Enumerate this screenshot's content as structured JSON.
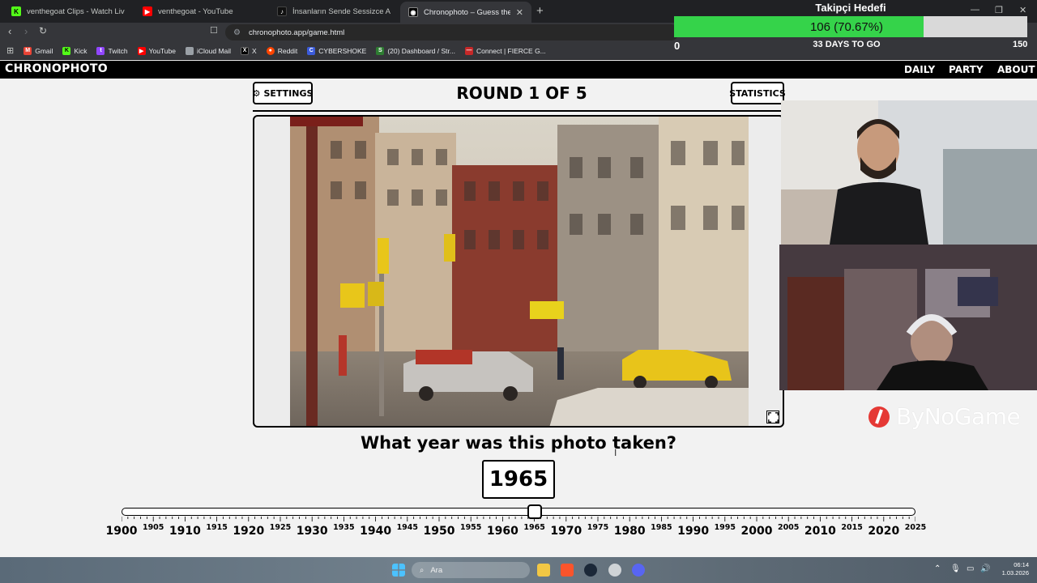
{
  "browser": {
    "tabs": [
      {
        "title": "venthegoat Clips - Watch Live on Kick",
        "icon": "kick-icon",
        "color": "#53fc18"
      },
      {
        "title": "venthegoat - YouTube",
        "icon": "youtube-icon",
        "color": "#ff0000"
      },
      {
        "title": "İnsanların Sende Sessizce Alkışladığı",
        "icon": "tiktok-icon",
        "color": "#111111"
      },
      {
        "title": "Chronophoto – Guess the Year of",
        "icon": "chronophoto-icon",
        "color": "#000000",
        "active": true
      }
    ],
    "url": "chronophoto.app/game.html",
    "bookmarks": [
      {
        "label": "Gmail",
        "color": "#ea4335"
      },
      {
        "label": "Kick",
        "color": "#53fc18"
      },
      {
        "label": "Twitch",
        "color": "#9146ff"
      },
      {
        "label": "YouTube",
        "color": "#ff0000"
      },
      {
        "label": "iCloud Mail",
        "color": "#9aa0a6"
      },
      {
        "label": "X",
        "color": "#000000"
      },
      {
        "label": "Reddit",
        "color": "#ff4500"
      },
      {
        "label": "CYBERSHOKE",
        "color": "#3b5bdb"
      },
      {
        "label": "(20) Dashboard / Str...",
        "color": "#2e7d32"
      },
      {
        "label": "Connect | FIERCE G...",
        "color": "#c62828"
      }
    ]
  },
  "site": {
    "logo": "CHRONOPHOTO",
    "nav": [
      "DAILY",
      "PARTY",
      "ABOUT"
    ]
  },
  "game": {
    "settings_label": "SETTINGS",
    "statistics_label": "STATISTICS",
    "round_title": "ROUND 1 OF 5",
    "question": "What year was this photo taken?",
    "selected_year": "1965",
    "slider": {
      "min": 1900,
      "max": 2025,
      "value": 1965,
      "major_ticks": [
        "1900",
        "1910",
        "1920",
        "1930",
        "1940",
        "1950",
        "1960",
        "1970",
        "1980",
        "1990",
        "2000",
        "2010",
        "2020"
      ],
      "minor_ticks": [
        "1905",
        "1915",
        "1925",
        "1935",
        "1945",
        "1955",
        "1965",
        "1975",
        "1985",
        "1995",
        "2005",
        "2015",
        "2025"
      ]
    }
  },
  "overlay": {
    "goal_title": "Takipçi Hedefi",
    "goal_text": "106 (70.67%)",
    "goal_fraction": 0.7067,
    "goal_min": "0",
    "goal_max": "150",
    "days_left": "33 DAYS TO GO",
    "brand": "ByNoGame",
    "goal_color": "#35d34a"
  },
  "taskbar": {
    "search_placeholder": "Ara",
    "time": "06:14",
    "date": "1.03.2026"
  }
}
